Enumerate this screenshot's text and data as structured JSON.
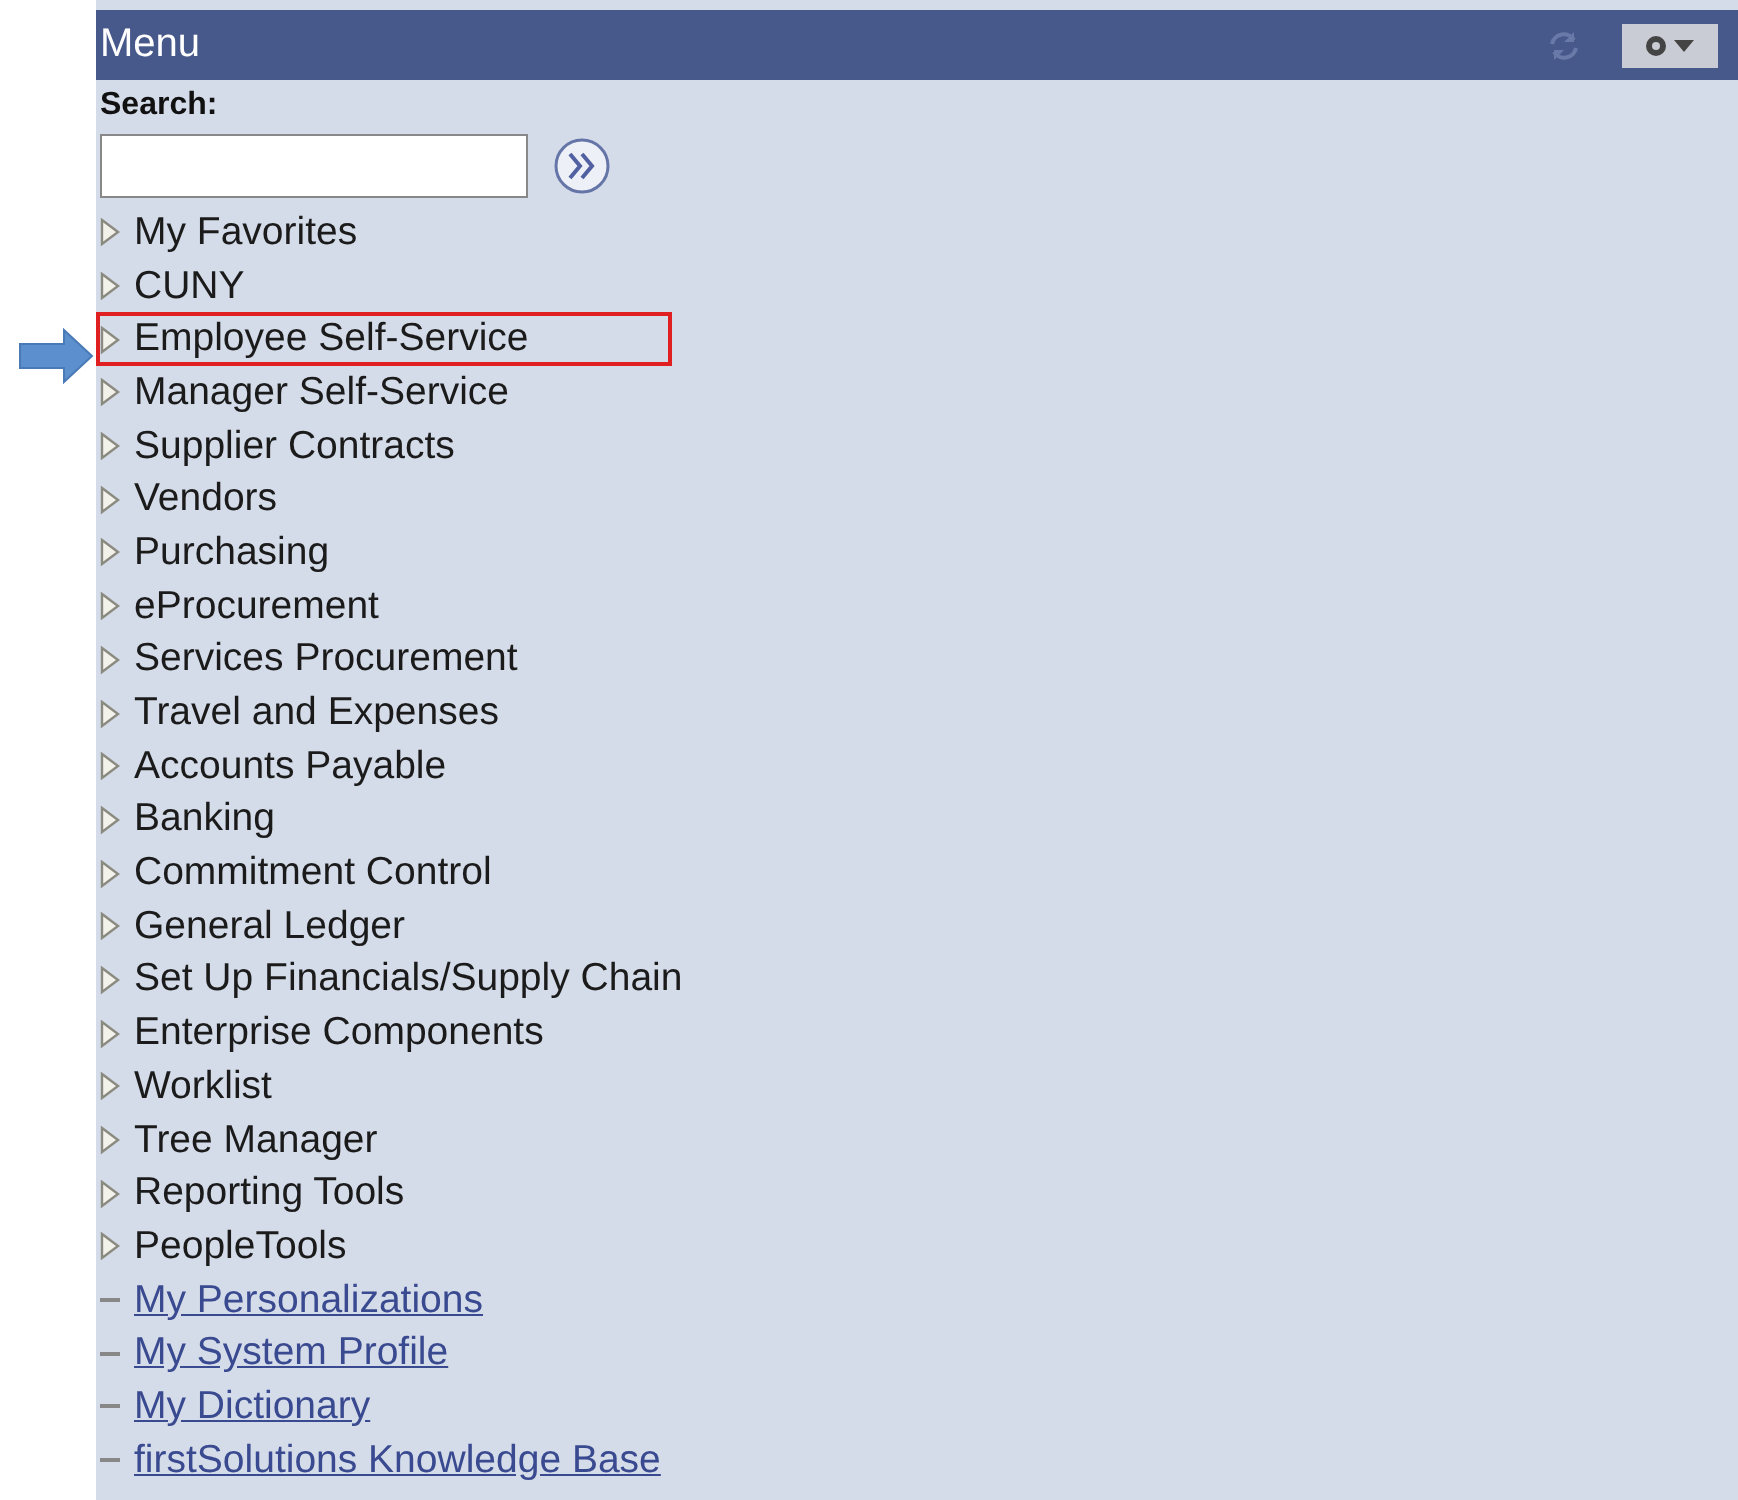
{
  "header": {
    "title": "Menu"
  },
  "search": {
    "label": "Search:"
  },
  "items": [
    {
      "label": "My Favorites",
      "kind": "folder",
      "highlighted": false
    },
    {
      "label": "CUNY",
      "kind": "folder",
      "highlighted": false
    },
    {
      "label": "Employee Self-Service",
      "kind": "folder",
      "highlighted": true
    },
    {
      "label": "Manager Self-Service",
      "kind": "folder",
      "highlighted": false
    },
    {
      "label": "Supplier Contracts",
      "kind": "folder",
      "highlighted": false
    },
    {
      "label": "Vendors",
      "kind": "folder",
      "highlighted": false
    },
    {
      "label": "Purchasing",
      "kind": "folder",
      "highlighted": false
    },
    {
      "label": "eProcurement",
      "kind": "folder",
      "highlighted": false
    },
    {
      "label": "Services Procurement",
      "kind": "folder",
      "highlighted": false
    },
    {
      "label": "Travel and Expenses",
      "kind": "folder",
      "highlighted": false
    },
    {
      "label": "Accounts Payable",
      "kind": "folder",
      "highlighted": false
    },
    {
      "label": "Banking",
      "kind": "folder",
      "highlighted": false
    },
    {
      "label": "Commitment Control",
      "kind": "folder",
      "highlighted": false
    },
    {
      "label": "General Ledger",
      "kind": "folder",
      "highlighted": false
    },
    {
      "label": "Set Up Financials/Supply Chain",
      "kind": "folder",
      "highlighted": false
    },
    {
      "label": "Enterprise Components",
      "kind": "folder",
      "highlighted": false
    },
    {
      "label": "Worklist",
      "kind": "folder",
      "highlighted": false
    },
    {
      "label": "Tree Manager",
      "kind": "folder",
      "highlighted": false
    },
    {
      "label": "Reporting Tools",
      "kind": "folder",
      "highlighted": false
    },
    {
      "label": "PeopleTools",
      "kind": "folder",
      "highlighted": false
    },
    {
      "label": "My Personalizations",
      "kind": "link",
      "highlighted": false
    },
    {
      "label": "My System Profile",
      "kind": "link",
      "highlighted": false
    },
    {
      "label": "My Dictionary",
      "kind": "link",
      "highlighted": false
    },
    {
      "label": "firstSolutions Knowledge Base",
      "kind": "link",
      "highlighted": false
    }
  ]
}
